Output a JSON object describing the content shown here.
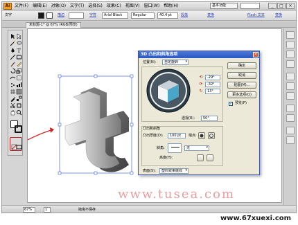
{
  "app": {
    "logo": "Ai"
  },
  "menu": [
    "文件(F)",
    "编辑(E)",
    "对象(O)",
    "文字(T)",
    "选择(S)",
    "效果(C)",
    "视图(V)",
    "窗口(W)",
    "帮助(H)"
  ],
  "workspace": {
    "label": "基本功能"
  },
  "window_buttons": [
    "_",
    "□",
    "×"
  ],
  "controlbar": {
    "type_label": "文字",
    "stroke_label": "描边",
    "char_label": "字符",
    "font": "Arial Black",
    "style": "Regular",
    "size": "40.4 pt",
    "para_label": "段落",
    "transform_label": "变换",
    "flash_label": "Flash 文本",
    "transform2_label": "变换"
  },
  "document_tab": "未标题-1* @ 67% (RGB/预览)",
  "statusbar": {
    "zoom": "67%",
    "page": "1",
    "status_text": "拖曳不保存"
  },
  "dialog": {
    "title": "3D 凸出和斜角选项",
    "position_label": "位置(N):",
    "position_value": "自定旋转",
    "rotation_x": "-29°",
    "rotation_y": "-32°",
    "rotation_z": "13°",
    "perspective_label": "透视(R):",
    "perspective_value": "50°",
    "extrude_section": "凸出和斜角",
    "extrude_depth_label": "凸出厚度(D):",
    "extrude_depth_value": "100 pt",
    "cap_label": "端点:",
    "bevel_label": "斜角:",
    "bevel_value": "无",
    "height_label": "高度(H):",
    "surface_label": "表面(S):",
    "surface_value": "塑料效果底纹",
    "buttons": {
      "ok": "确定",
      "cancel": "取消",
      "map": "贴图(M)...",
      "more": "更多选项(O)",
      "preview": "预览(P)"
    },
    "preview_checked": true
  },
  "watermark": "www.tusea.com",
  "corner_brand": "www.67xuexi.com"
}
